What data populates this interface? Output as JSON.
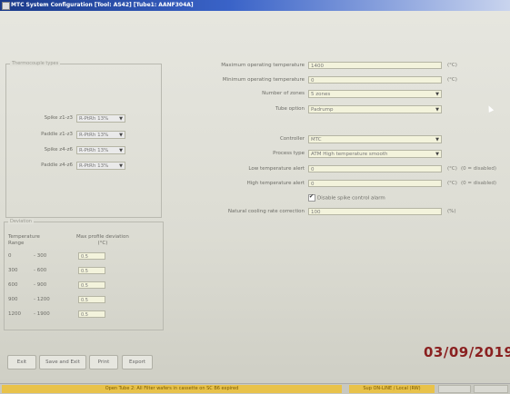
{
  "window": {
    "title": "MTC System Configuration [Tool: AS42] [Tube1: AANF304A]"
  },
  "thermocouple": {
    "title": "Thermocouple types",
    "rows": [
      {
        "label": "Spike z1-z3",
        "value": "R-PtRh 13%"
      },
      {
        "label": "Paddle z1-z3",
        "value": "R-PtRh 13%"
      },
      {
        "label": "Spike z4-z6",
        "value": "R-PtRh 13%"
      },
      {
        "label": "Paddle z4-z6",
        "value": "R-PtRh 13%"
      }
    ]
  },
  "settings": {
    "max_temp": {
      "label": "Maximum operating temperature",
      "value": "1400",
      "unit": "(°C)"
    },
    "min_temp": {
      "label": "Minimum operating temperature",
      "value": "0",
      "unit": "(°C)"
    },
    "zones": {
      "label": "Number of zones",
      "value": "5 zones"
    },
    "tube": {
      "label": "Tube option",
      "value": "Padrump"
    },
    "controller": {
      "label": "Controller",
      "value": "MTC"
    },
    "process": {
      "label": "Process type",
      "value": "ATM High temperature smooth"
    },
    "low_alert": {
      "label": "Low temperature alert",
      "value": "0",
      "unit": "(°C)",
      "note": "(0 = disabled)"
    },
    "high_alert": {
      "label": "High temperature alert",
      "value": "0",
      "unit": "(°C)",
      "note": "(0 = disabled)"
    },
    "spike_alarm": {
      "label": "Disable spike control alarm",
      "checked": true,
      "mark": "✔"
    },
    "cooling": {
      "label": "Natural cooling rate correction",
      "value": "100",
      "unit": "(%)"
    }
  },
  "deviation": {
    "title": "Deviation",
    "col1_header": "Temperature\nRange",
    "col2_header": "Max profile deviation\n(°C)",
    "rows": [
      {
        "from": "0",
        "to": "- 300",
        "value": "0.5"
      },
      {
        "from": "300",
        "to": "- 600",
        "value": "0.5"
      },
      {
        "from": "600",
        "to": "- 900",
        "value": "0.5"
      },
      {
        "from": "900",
        "to": "- 1200",
        "value": "0.5"
      },
      {
        "from": "1200",
        "to": "- 1900",
        "value": "0.5"
      }
    ]
  },
  "buttons": {
    "exit": "Exit",
    "save_exit": "Save and Exit",
    "print": "Print",
    "export": "Export"
  },
  "overlay": {
    "date": "03/09/2019"
  },
  "status": {
    "message": "Open Tube 2: All Filter wafers in cassette on SC B6 expired",
    "mode": "Sup ON-LINE / Local (RW)",
    "color": "#e8c24a"
  }
}
